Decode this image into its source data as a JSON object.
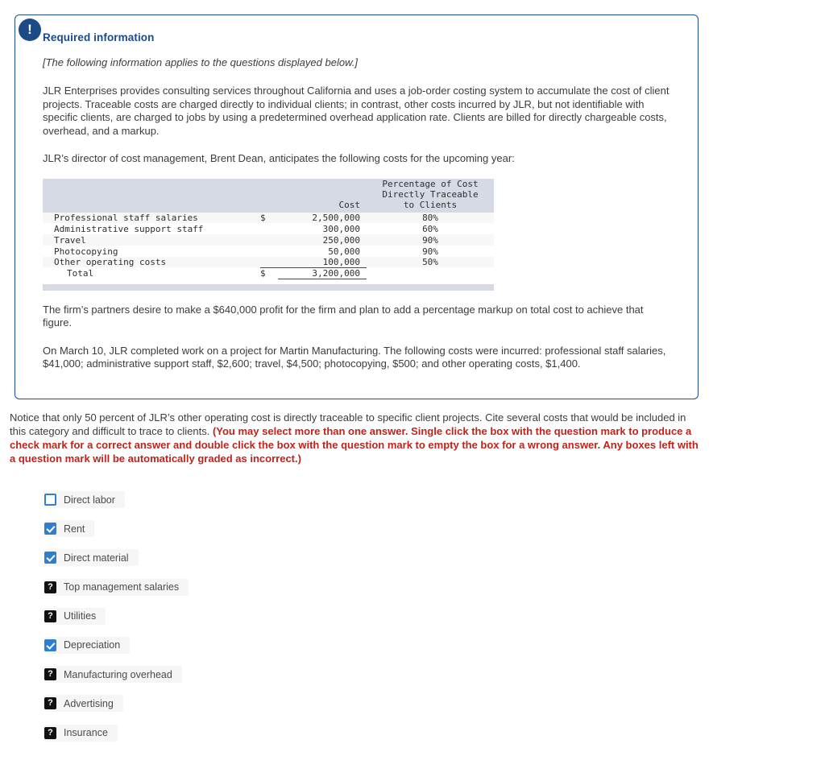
{
  "callout": {
    "icon": "exclamation-icon",
    "icon_glyph": "!",
    "title": "Required information",
    "italic_note": "[The following information applies to the questions displayed below.]",
    "paragraph_1": "JLR Enterprises provides consulting services throughout California and uses a job-order costing system to accumulate the cost of client projects. Traceable costs are charged directly to individual clients; in contrast, other costs incurred by JLR, but not identifiable with specific clients, are charged to jobs by using a predetermined overhead application rate. Clients are billed for directly chargeable costs, overhead, and a markup.",
    "paragraph_2": "JLR’s director of cost management, Brent Dean, anticipates the following costs for the upcoming year:",
    "paragraph_3": "The firm’s partners desire to make a $640,000 profit for the firm and plan to add a percentage markup on total cost to achieve that figure.",
    "paragraph_4": "On March 10, JLR completed work on a project for Martin Manufacturing. The following costs were incurred: professional staff salaries, $41,000; administrative support staff, $2,600; travel, $4,500; photocopying, $500; and other operating costs, $1,400."
  },
  "cost_table": {
    "headers": {
      "label": "",
      "dollar": "",
      "cost": "Cost",
      "percentage_line1": "Percentage of Cost",
      "percentage_line2": "Directly Traceable",
      "percentage_line3": "to Clients"
    },
    "rows": [
      {
        "label": "Professional staff salaries",
        "dollar": "$",
        "cost": "2,500,000",
        "pct": "80%"
      },
      {
        "label": "Administrative support staff",
        "dollar": "",
        "cost": "300,000",
        "pct": "60%"
      },
      {
        "label": "Travel",
        "dollar": "",
        "cost": "250,000",
        "pct": "90%"
      },
      {
        "label": "Photocopying",
        "dollar": "",
        "cost": "50,000",
        "pct": "90%"
      },
      {
        "label": "Other operating costs",
        "dollar": "",
        "cost": "100,000",
        "pct": "50%"
      }
    ],
    "total": {
      "label": "Total",
      "dollar": "$",
      "cost": "3,200,000",
      "pct": ""
    }
  },
  "question": {
    "text_normal": "Notice that only 50 percent of JLR’s other operating cost is directly traceable to specific client projects. Cite several costs that would be included in this category and difficult to trace to clients. ",
    "text_warning": "(You may select more than one answer. Single click the box with the question mark to produce a check mark for a correct answer and double click the box with the question mark to empty the box for a wrong answer. Any boxes left with a question mark will be automatically graded as incorrect.)",
    "warning_color": "#c0231b"
  },
  "options": [
    {
      "label": "Direct labor",
      "state": "unchecked",
      "glyph": ""
    },
    {
      "label": "Rent",
      "state": "checked",
      "glyph": ""
    },
    {
      "label": "Direct material",
      "state": "checked",
      "glyph": ""
    },
    {
      "label": "Top management salaries",
      "state": "question",
      "glyph": "?"
    },
    {
      "label": "Utilities",
      "state": "question",
      "glyph": "?"
    },
    {
      "label": "Depreciation",
      "state": "checked",
      "glyph": ""
    },
    {
      "label": "Manufacturing overhead",
      "state": "question",
      "glyph": "?"
    },
    {
      "label": "Advertising",
      "state": "question",
      "glyph": "?"
    },
    {
      "label": "Insurance",
      "state": "question",
      "glyph": "?"
    }
  ],
  "colors": {
    "callout_border": "#1d4e8f",
    "callout_title": "#1b4a87",
    "icon_bg": "#1b4a87",
    "table_header_bg": "#d6dae5",
    "checkbox_blue": "#2f7fd0",
    "question_box_bg": "#111111"
  }
}
